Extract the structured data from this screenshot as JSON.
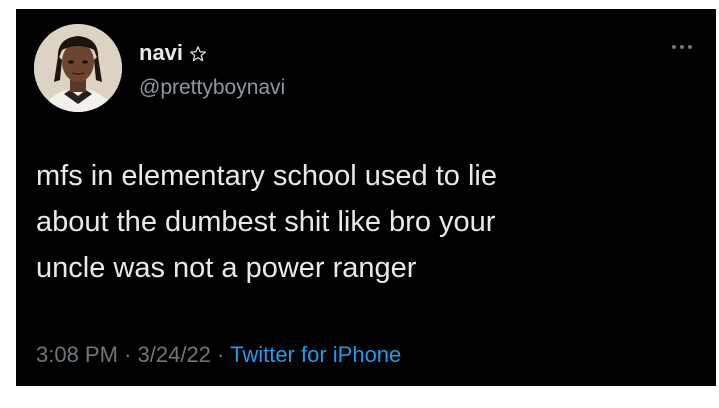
{
  "tweet": {
    "author": {
      "display_name": "navi",
      "name_badge_icon": "outlined-star-icon",
      "handle": "@prettyboynavi",
      "avatar_icon": "profile-photo"
    },
    "more_icon": "ellipsis-icon",
    "text": "mfs in elementary school used to lie\nabout the dumbest shit like bro your\nuncle was not a power ranger",
    "time": "3:08 PM",
    "date": "3/24/22",
    "separator": "·",
    "source": "Twitter for iPhone"
  },
  "colors": {
    "background": "#000000",
    "primary_text": "#e7e9ea",
    "secondary_text": "#6e767d",
    "link": "#1d9bf0"
  }
}
